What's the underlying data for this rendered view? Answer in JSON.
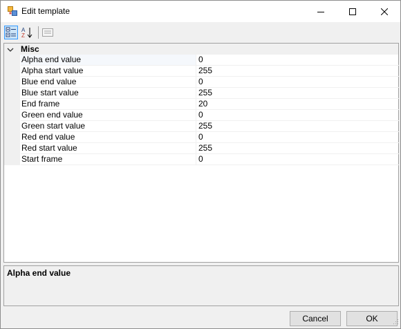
{
  "window": {
    "title": "Edit template",
    "icon": "app-template-icon",
    "controls": [
      "minimize-icon",
      "maximize-icon",
      "close-icon"
    ]
  },
  "toolbar": {
    "buttons": [
      {
        "name": "categorized-button",
        "icon": "categorized-icon",
        "active": true
      },
      {
        "name": "alphabetical-button",
        "icon": "sort-az-icon",
        "active": false
      },
      {
        "name": "property-pages-button",
        "icon": "property-pages-icon",
        "active": false,
        "disabled": true
      }
    ]
  },
  "grid": {
    "category": "Misc",
    "properties": [
      {
        "name": "Alpha end value",
        "value": "0"
      },
      {
        "name": "Alpha start value",
        "value": "255"
      },
      {
        "name": "Blue end value",
        "value": "0"
      },
      {
        "name": "Blue start value",
        "value": "255"
      },
      {
        "name": "End frame",
        "value": "20"
      },
      {
        "name": "Green end value",
        "value": "0"
      },
      {
        "name": "Green start value",
        "value": "255"
      },
      {
        "name": "Red end value",
        "value": "0"
      },
      {
        "name": "Red start value",
        "value": "255"
      },
      {
        "name": "Start frame",
        "value": "0"
      }
    ],
    "selected_index": 0
  },
  "description": {
    "title": "Alpha end value"
  },
  "buttons": {
    "cancel": "Cancel",
    "ok": "OK"
  },
  "colors": {
    "accent": "#3399ff",
    "toolbar_active_bg": "#cce4f7",
    "gutter": "#f0f0f0"
  }
}
